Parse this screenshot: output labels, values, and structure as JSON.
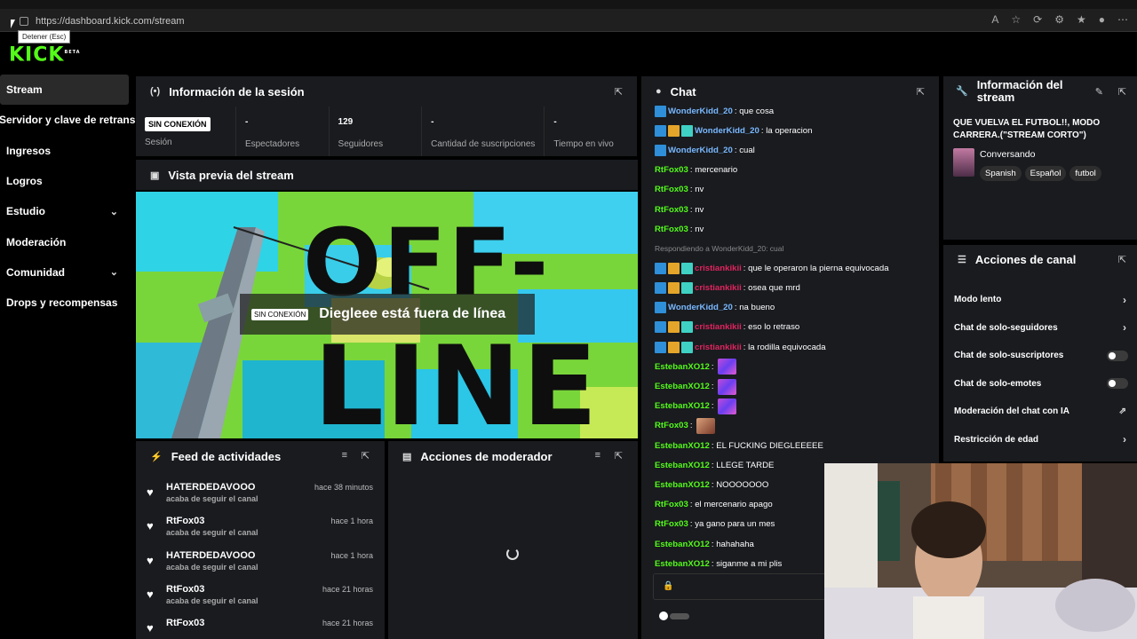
{
  "browser": {
    "url": "https://dashboard.kick.com/stream",
    "tooltip": "Detener (Esc)"
  },
  "logo": {
    "text": "KICK",
    "sup": "BETA"
  },
  "sidebar": {
    "items": [
      {
        "label": "Stream",
        "active": true
      },
      {
        "label": "Servidor y clave de retransn"
      },
      {
        "label": "Ingresos"
      },
      {
        "label": "Logros"
      },
      {
        "label": "Estudio",
        "expand": true
      },
      {
        "label": "Moderación"
      },
      {
        "label": "Comunidad",
        "expand": true
      },
      {
        "label": "Drops y recompensas"
      }
    ]
  },
  "session": {
    "title": "Información de la sesión",
    "status_badge": "SIN CONEXIÓN",
    "stats": [
      {
        "value": "",
        "label": "Sesión"
      },
      {
        "value": "-",
        "label": "Espectadores"
      },
      {
        "value": "129",
        "label": "Seguidores"
      },
      {
        "value": "-",
        "label": "Cantidad de suscripciones"
      },
      {
        "value": "-",
        "label": "Tiempo en vivo"
      }
    ]
  },
  "preview": {
    "title": "Vista previa del stream",
    "badge": "SIN CONEXIÓN",
    "message": "Diegleee está fuera de línea",
    "art_line1": "OFF-",
    "art_line2": "LINE"
  },
  "feed": {
    "title": "Feed de actividades",
    "items": [
      {
        "name": "HATERDEDAVOOO",
        "action": "acaba de seguir el canal",
        "time": "hace 38 minutos"
      },
      {
        "name": "RtFox03",
        "action": "acaba de seguir el canal",
        "time": "hace 1 hora"
      },
      {
        "name": "HATERDEDAVOOO",
        "action": "acaba de seguir el canal",
        "time": "hace 1 hora"
      },
      {
        "name": "RtFox03",
        "action": "acaba de seguir el canal",
        "time": "hace 21 horas"
      },
      {
        "name": "RtFox03",
        "action": "",
        "time": "hace 21 horas"
      }
    ]
  },
  "mod_actions": {
    "title": "Acciones de moderador"
  },
  "chat": {
    "title": "Chat",
    "reply_note": "Respondiendo a WonderKidd_20: cual",
    "messages": [
      {
        "user": "WonderKidd_20",
        "text": ": que cosa",
        "color": "#79b8ff",
        "badges": 1
      },
      {
        "user": "WonderKidd_20",
        "text": ": la operacion",
        "color": "#79b8ff",
        "badges": 3
      },
      {
        "user": "WonderKidd_20",
        "text": ": cual",
        "color": "#79b8ff",
        "badges": 1
      },
      {
        "user": "RtFox03",
        "text": ": mercenario",
        "color": "#53fc18",
        "badges": 0
      },
      {
        "user": "RtFox03",
        "text": ": nv",
        "color": "#53fc18",
        "badges": 0
      },
      {
        "user": "RtFox03",
        "text": ": nv",
        "color": "#53fc18",
        "badges": 0
      },
      {
        "user": "RtFox03",
        "text": ": nv",
        "color": "#53fc18",
        "badges": 0
      },
      {
        "user": "cristiankikii",
        "text": ": que le operaron la pierna equivocada",
        "color": "#e0245e",
        "badges": 3
      },
      {
        "user": "cristiankikii",
        "text": ": osea que mrd",
        "color": "#e0245e",
        "badges": 3
      },
      {
        "user": "WonderKidd_20",
        "text": ": na bueno",
        "color": "#79b8ff",
        "badges": 1
      },
      {
        "user": "cristiankikii",
        "text": ": eso lo retraso",
        "color": "#e0245e",
        "badges": 3
      },
      {
        "user": "cristiankikii",
        "text": ": la rodilla equivocada",
        "color": "#e0245e",
        "badges": 3
      },
      {
        "user": "EstebanXO12",
        "text": ":",
        "color": "#53fc18",
        "badges": 0,
        "emote": "purple"
      },
      {
        "user": "EstebanXO12",
        "text": ":",
        "color": "#53fc18",
        "badges": 0,
        "emote": "purple"
      },
      {
        "user": "EstebanXO12",
        "text": ":",
        "color": "#53fc18",
        "badges": 0,
        "emote": "purple"
      },
      {
        "user": "RtFox03",
        "text": ":",
        "color": "#53fc18",
        "badges": 0,
        "emote": "face"
      },
      {
        "user": "EstebanXO12",
        "text": ": EL FUCKING DIEGLEEEEE",
        "color": "#53fc18",
        "badges": 0
      },
      {
        "user": "EstebanXO12",
        "text": ": LLEGE TARDE",
        "color": "#53fc18",
        "badges": 0
      },
      {
        "user": "EstebanXO12",
        "text": ": NOOOOOOO",
        "color": "#53fc18",
        "badges": 0
      },
      {
        "user": "RtFox03",
        "text": ": el mercenario apago",
        "color": "#53fc18",
        "badges": 0
      },
      {
        "user": "RtFox03",
        "text": ": ya gano para un mes",
        "color": "#53fc18",
        "badges": 0
      },
      {
        "user": "EstebanXO12",
        "text": ": hahahaha",
        "color": "#53fc18",
        "badges": 0
      },
      {
        "user": "EstebanXO12",
        "text": ": siganme a mi plis",
        "color": "#53fc18",
        "badges": 0
      }
    ]
  },
  "stream_info": {
    "title": "Información del stream",
    "stream_title": "QUE VUELVA EL FUTBOL!!, MODO CARRERA.(\"STREAM CORTO\")",
    "category": "Conversando",
    "tags": [
      "Spanish",
      "Español",
      "futbol"
    ]
  },
  "channel_actions": {
    "title": "Acciones de canal",
    "items": [
      {
        "label": "Modo lento",
        "type": "arrow"
      },
      {
        "label": "Chat de solo-seguidores",
        "type": "arrow"
      },
      {
        "label": "Chat de solo-suscriptores",
        "type": "toggle"
      },
      {
        "label": "Chat de solo-emotes",
        "type": "toggle"
      },
      {
        "label": "Moderación del chat con IA",
        "type": "external"
      },
      {
        "label": "Restricción de edad",
        "type": "arrow"
      }
    ]
  },
  "colors": {
    "accent": "#53fc18",
    "panel": "#191b1f",
    "bg": "#000000"
  }
}
